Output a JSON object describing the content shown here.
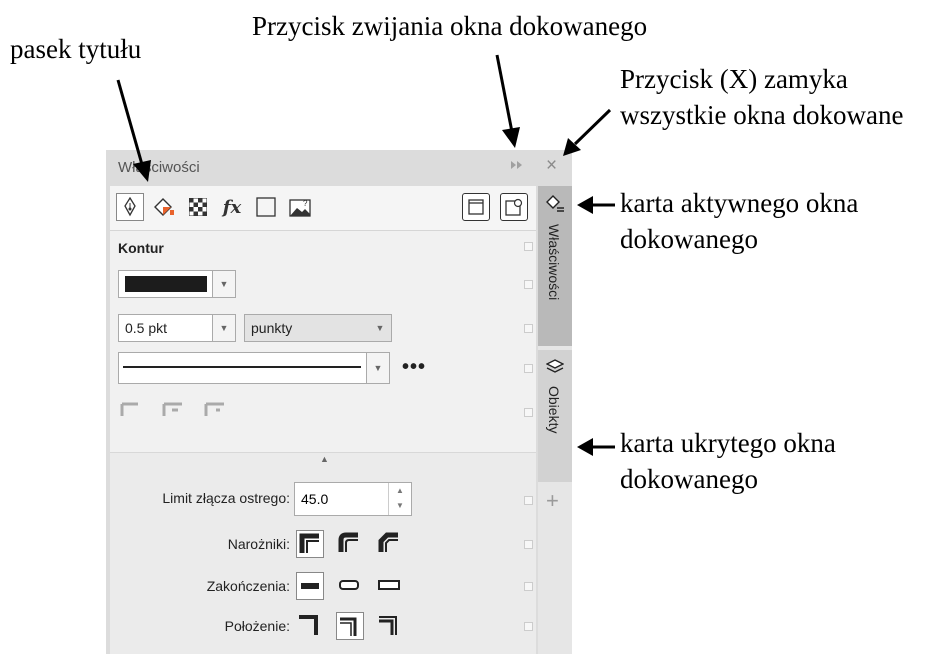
{
  "annotations": {
    "title_bar": "pasek tytułu",
    "collapse_button": "Przycisk zwijania okna dokowanego",
    "close_button_line1": "Przycisk (X) zamyka",
    "close_button_line2": "wszystkie okna dokowane",
    "active_tab_line1": "karta aktywnego okna",
    "active_tab_line2": "dokowanego",
    "hidden_tab_line1": "karta ukrytego okna",
    "hidden_tab_line2": "dokowanego"
  },
  "docker": {
    "title": "Właściwości",
    "collapse_glyph": "⏩",
    "close_glyph": "×",
    "toolbar_icons": [
      "pen-nib-icon",
      "fill-bucket-icon",
      "checker-transparency-icon",
      "fx-effects-icon",
      "frame-icon",
      "image-icon",
      "snap-frame-icon",
      "settings-frame-icon"
    ],
    "section_title": "Kontur",
    "outline_color": "#1c1c1c",
    "width_value": "0.5 pkt",
    "width_unit": "punkty",
    "more_glyph": "•••",
    "miter_label": "Limit złącza ostrego:",
    "miter_value": "45.0",
    "corners_label": "Narożniki:",
    "caps_label": "Zakończenia:",
    "position_label": "Położenie:",
    "tabs": {
      "active": "Właściwości",
      "hidden": "Obiekty",
      "add_glyph": "+"
    }
  }
}
